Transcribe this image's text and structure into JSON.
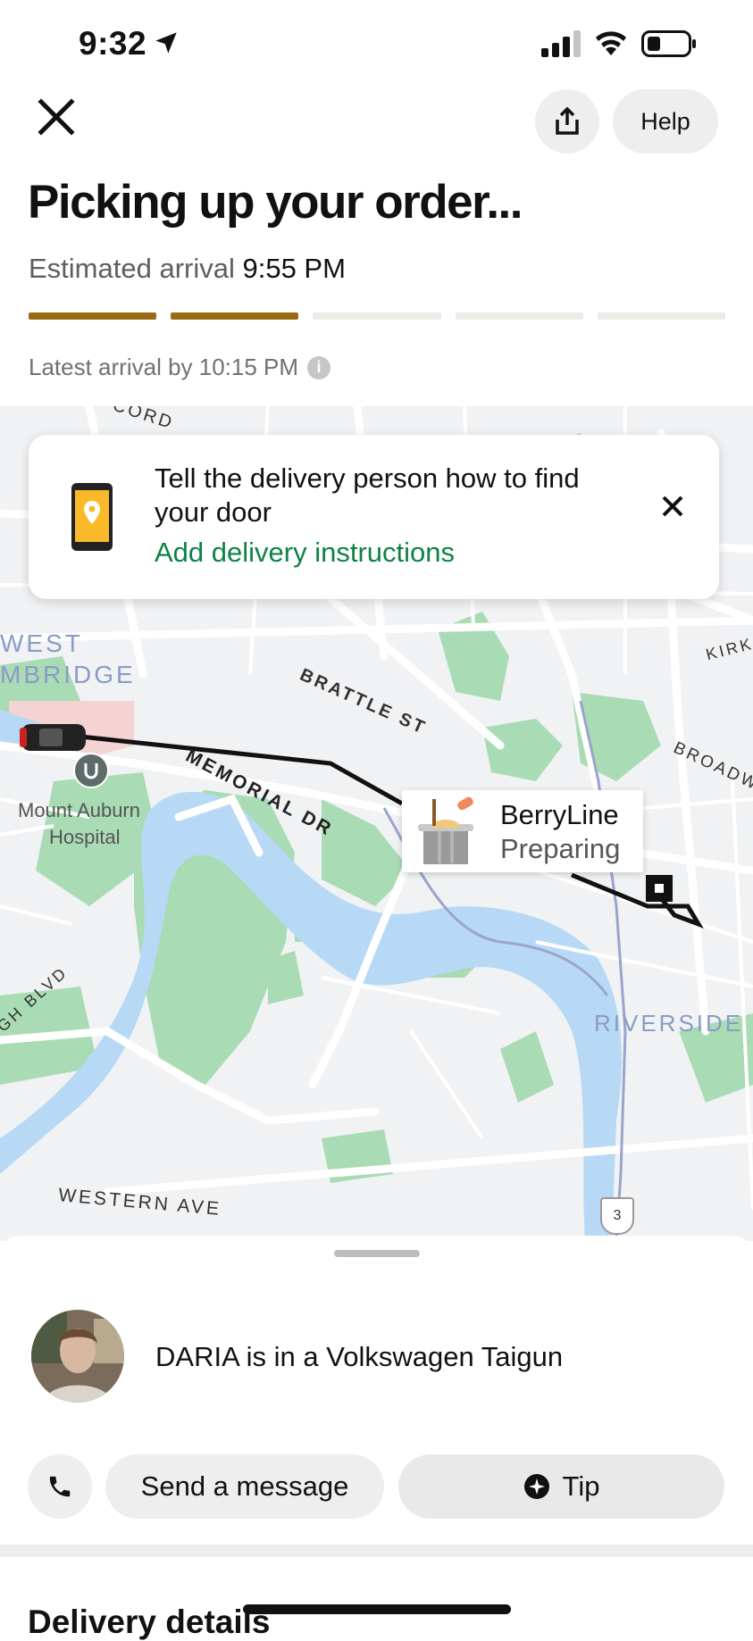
{
  "status_bar": {
    "time": "9:32"
  },
  "header": {
    "close_icon": "close-icon",
    "share_icon": "share-icon",
    "help_label": "Help"
  },
  "order": {
    "title": "Picking up your order...",
    "eta_label": "Estimated arrival",
    "eta_time": "9:55 PM",
    "progress": {
      "total_steps": 5,
      "completed_steps": 2,
      "active_color": "#9b6a14",
      "inactive_color": "#ecece6"
    },
    "latest_arrival": "Latest arrival by 10:15 PM"
  },
  "banner": {
    "text": "Tell the delivery person how to find your door",
    "link": "Add delivery instructions",
    "link_color": "#0e8345"
  },
  "map": {
    "labels": {
      "west_cambridge_1": "WEST",
      "west_cambridge_2": "MBRIDGE",
      "concord": "CORD",
      "brattle": "BRATTLE ST",
      "memorial": "MEMORIAL DR",
      "kirk": "KIRK",
      "broadway": "BROADW",
      "hospital_1": "Mount Auburn",
      "hospital_2": "Hospital",
      "riverside": "RIVERSIDE",
      "soldiers": "UGH BLVD",
      "western": "WESTERN AVE",
      "route": "3"
    },
    "restaurant": {
      "name": "BerryLine",
      "status": "Preparing"
    }
  },
  "driver": {
    "text": "DARIA is in a Volkswagen Taigun"
  },
  "actions": {
    "message_label": "Send a message",
    "tip_label": "Tip"
  },
  "delivery": {
    "section_title": "Delivery details"
  }
}
